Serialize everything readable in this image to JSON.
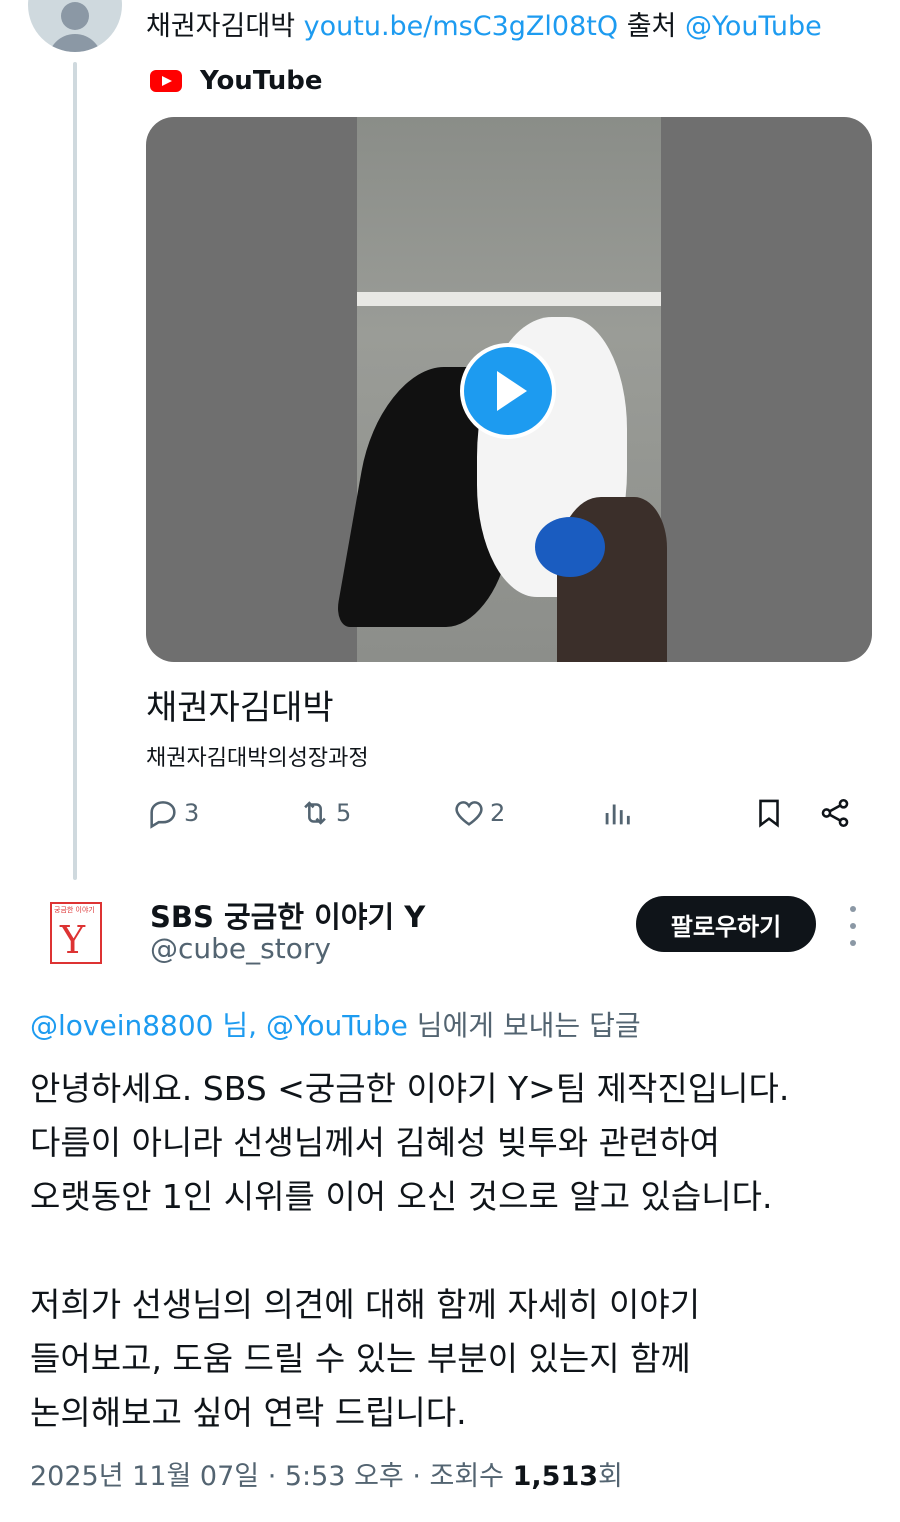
{
  "top_tweet": {
    "author_text": "채권자김대박",
    "link_text": "youtu.be/msC3gZl08tQ",
    "source_word": "출처",
    "source_handle": "@YouTube",
    "card_provider": "YouTube",
    "card_title": "채권자김대박",
    "card_description": "채권자김대박의성장과정",
    "reply_count": "3",
    "retweet_count": "5",
    "like_count": "2"
  },
  "reply_tweet": {
    "author_name": "SBS 궁금한 이야기 Y",
    "author_handle": "@cube_story",
    "logo_small_text": "궁금한 이야기",
    "logo_letter": "Y",
    "follow_label": "팔로우하기",
    "reply_to_users": "@lovein8800 님, @YouTube",
    "reply_to_suffix": " 님에게 보내는 답글",
    "body": "안녕하세요. SBS <궁금한 이야기 Y>팀 제작진입니다.\n다름이 아니라 선생님께서 김혜성 빚투와 관련하여\n오랫동안 1인 시위를 이어 오신 것으로 알고 있습니다.\n\n저희가 선생님의 의견에 대해 함께 자세히 이야기\n들어보고, 도움 드릴 수 있는 부분이 있는지 함께\n논의해보고 싶어 연락 드립니다.",
    "timestamp": "2025년 11월 07일 · 5:53 오후 · 조회수 ",
    "views": "1,513",
    "views_suffix": "회"
  },
  "colors": {
    "link": "#1d9bf0",
    "secondary_text": "#536471",
    "follow_button": "#0f1419"
  }
}
